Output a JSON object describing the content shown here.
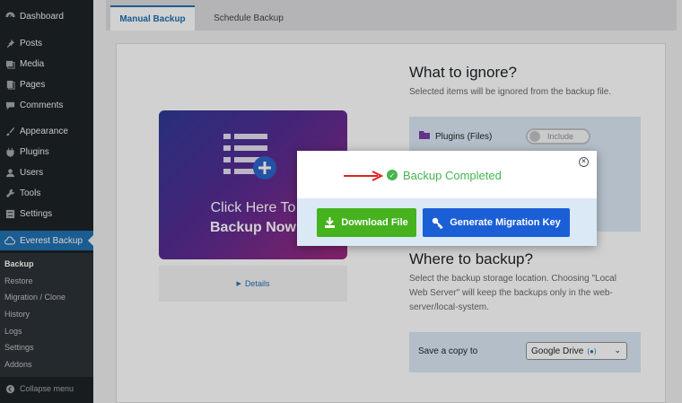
{
  "sidebar": {
    "items": [
      {
        "label": "Dashboard",
        "icon": "dashboard-icon"
      },
      {
        "label": "Posts",
        "icon": "pin-icon"
      },
      {
        "label": "Media",
        "icon": "media-icon"
      },
      {
        "label": "Pages",
        "icon": "pages-icon"
      },
      {
        "label": "Comments",
        "icon": "comment-icon"
      },
      {
        "label": "Appearance",
        "icon": "brush-icon"
      },
      {
        "label": "Plugins",
        "icon": "plugin-icon"
      },
      {
        "label": "Users",
        "icon": "user-icon"
      },
      {
        "label": "Tools",
        "icon": "wrench-icon"
      },
      {
        "label": "Settings",
        "icon": "settings-icon"
      },
      {
        "label": "Everest Backup",
        "icon": "cloud-icon"
      }
    ],
    "submenu": [
      "Backup",
      "Restore",
      "Migration / Clone",
      "History",
      "Logs",
      "Settings",
      "Addons"
    ],
    "collapse": "Collapse menu"
  },
  "tabs": [
    "Manual Backup",
    "Schedule Backup"
  ],
  "card": {
    "line1": "Click Here To",
    "line2": "Backup Now"
  },
  "details": "Details",
  "ignore": {
    "title": "What to ignore?",
    "desc": "Selected items will be ignored from the backup file.",
    "plugins_label": "Plugins (Files)",
    "toggle_label": "Include"
  },
  "where": {
    "title": "Where to backup?",
    "desc_lines": [
      "Select the backup storage location. Choosing \"Local",
      "Web Server\" will keep the backups only in the web-",
      "server/local-system."
    ],
    "save_label": "Save a copy to",
    "select_value": "Google Drive"
  },
  "modal": {
    "status": "Backup Completed",
    "download_label": "Download File",
    "migration_label": "Generate Migration Key"
  },
  "colors": {
    "accent": "#2271b1",
    "success": "#46b450",
    "download": "#46b21e",
    "migration": "#1b5fd6"
  }
}
